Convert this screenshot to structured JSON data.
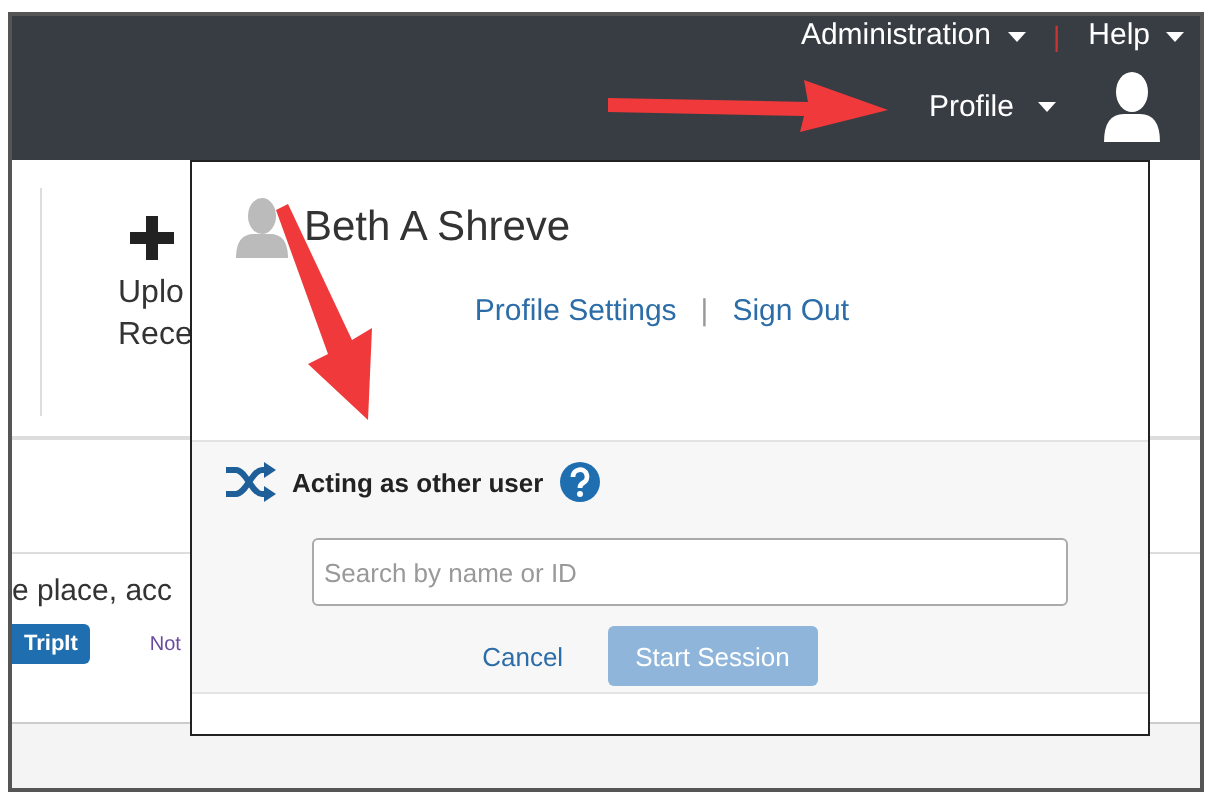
{
  "top_menu": {
    "items": [
      {
        "label": "Administration"
      },
      {
        "label": "Help"
      }
    ],
    "separator": "|"
  },
  "profile_menu": {
    "label": "Profile"
  },
  "background": {
    "tile_label_lines": [
      "Uplo",
      "Rece"
    ],
    "banner_text": "e place, acc",
    "tripit_button": "TripIt",
    "note_link": "Not"
  },
  "dropdown": {
    "user_name": "Beth A Shreve",
    "links": [
      "Profile Settings",
      "Sign Out"
    ],
    "link_separator": "|",
    "section_title": "Acting as other user",
    "search": {
      "placeholder": "Search by name or ID"
    },
    "cancel": "Cancel",
    "start": {
      "label": "Start Session",
      "disabled": true
    }
  }
}
